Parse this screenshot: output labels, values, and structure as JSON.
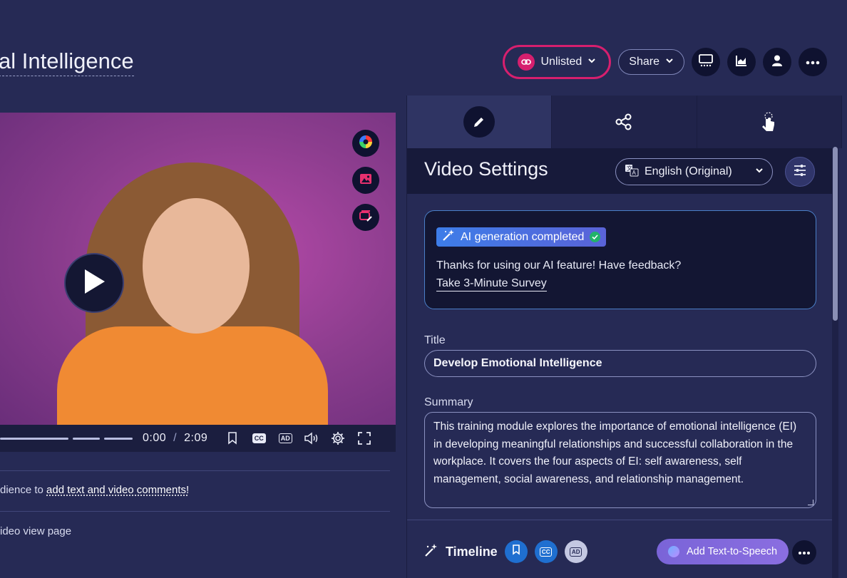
{
  "header": {
    "title": "al Intelligence",
    "visibility_label": "Unlisted",
    "share_label": "Share",
    "icons": [
      "link-icon",
      "chevron-down-icon",
      "monitor-icon",
      "analytics-icon",
      "user-icon",
      "more-icon"
    ]
  },
  "video": {
    "current_time": "0:00",
    "separator": "/",
    "duration": "2:09",
    "cc_label": "CC",
    "ad_label": "AD",
    "tool_icons": [
      "color-wheel-icon",
      "image-icon",
      "edit-overlay-icon"
    ]
  },
  "left_info": {
    "comments_prefix": "dience to ",
    "comments_link": "add text and video comments!",
    "view_page_text": "ideo view page"
  },
  "panel": {
    "tabs": [
      "edit-icon",
      "share-nodes-icon",
      "interaction-icon"
    ],
    "settings_title": "Video Settings",
    "language": "English (Original)",
    "ai": {
      "badge": "AI generation completed",
      "message": "Thanks for using our AI feature! Have feedback?",
      "survey_link": "Take 3-Minute Survey"
    },
    "title_label": "Title",
    "title_value": "Develop Emotional Intelligence",
    "summary_label": "Summary",
    "summary_value": "This training module explores the importance of emotional intelligence (EI) in developing meaningful relationships and successful collaboration in the workplace. It covers the four aspects of EI: self awareness, self management, social awareness, and relationship management.",
    "timeline": {
      "label": "Timeline",
      "cc_label": "CC",
      "ad_label": "AD",
      "tts_label": "Add Text-to-Speech"
    }
  },
  "colors": {
    "accent": "#d61f6e",
    "background": "#262a55",
    "panel_dark": "#171a3a",
    "ai_badge": "#3d7de8",
    "tts_button": "#7a64d8"
  }
}
